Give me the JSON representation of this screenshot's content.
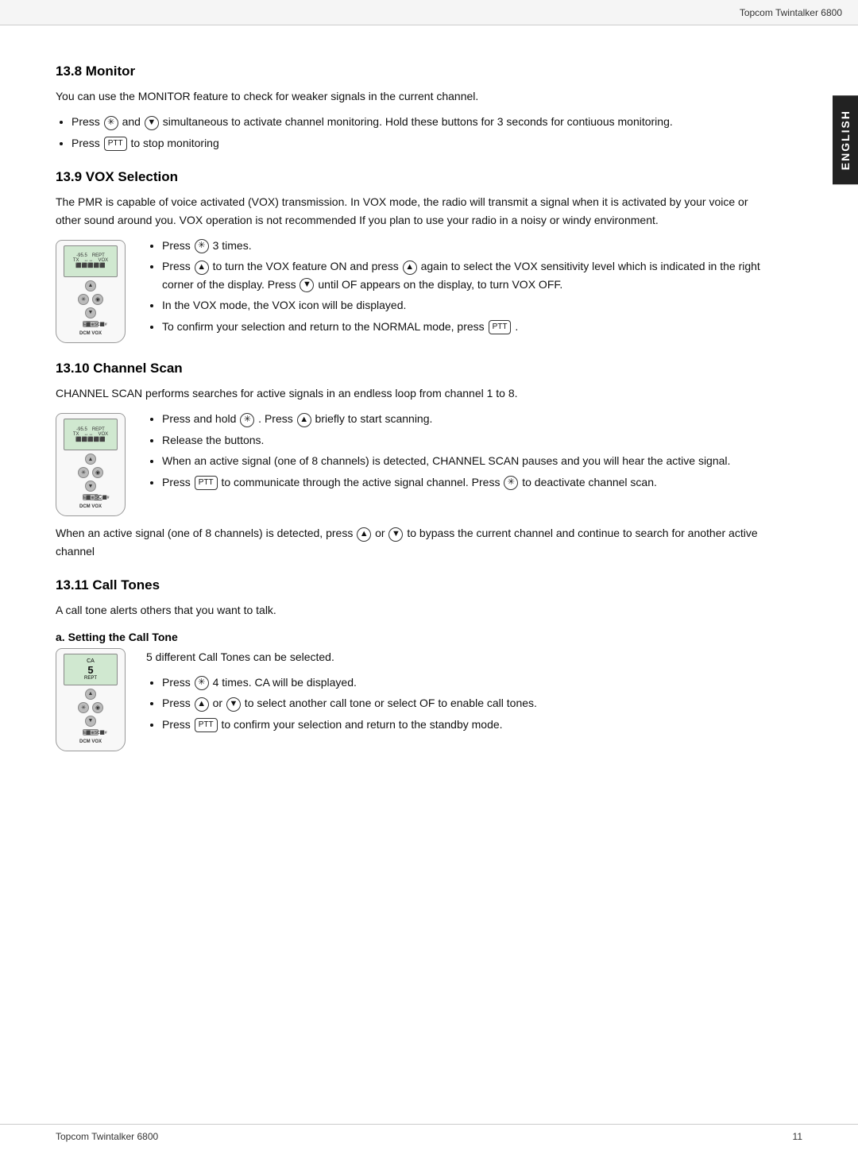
{
  "header": {
    "title": "Topcom Twintalker 6800"
  },
  "side_tab": {
    "label": "ENGLISH"
  },
  "sections": {
    "s13_8": {
      "heading": "13.8   Monitor",
      "intro": "You can use the MONITOR feature to check for weaker signals in the current channel.",
      "bullets": [
        "Press ⊛ and ▼ simultaneous to activate channel monitoring. Hold these buttons for 3 seconds for contiuous monitoring.",
        "Press PTT to stop monitoring"
      ]
    },
    "s13_9": {
      "heading": "13.9   VOX Selection",
      "intro": "The PMR is capable of voice activated (VOX) transmission. In VOX mode, the radio will transmit a signal when it is activated by your voice or other sound around you. VOX operation is not recommended If you plan to use your radio in a noisy or windy environment.",
      "bullets": [
        "Press ⊛ 3 times.",
        "Press ▲ to turn the VOX feature ON and press ▲ again to select the VOX sensitivity level which is indicated in the right corner of the display. Press ▼ until OF appears on the display, to turn VOX OFF.",
        "In the VOX mode, the VOX icon will be displayed.",
        "To confirm your selection and return to the NORMAL mode, press PTT ."
      ]
    },
    "s13_10": {
      "heading": "13.10  Channel Scan",
      "intro": "CHANNEL SCAN performs searches for active signals in an endless loop from channel 1 to 8.",
      "bullets": [
        "Press and hold ⊛ . Press ▲ briefly to start scanning.",
        "Release the buttons.",
        "When an active signal (one of 8 channels) is detected, CHANNEL SCAN pauses and you will hear the active signal.",
        "Press PTT to communicate through the active signal channel. Press ⊛ to deactivate channel scan."
      ],
      "followup": "When an active signal (one of 8 channels) is detected, press ▲ or ▼ to bypass the current channel and continue to search for another active channel"
    },
    "s13_11": {
      "heading": "13.11  Call Tones",
      "intro": "A call tone alerts others that you want to talk.",
      "sub_a": {
        "heading": "a.   Setting the Call Tone",
        "intro": "5 different Call Tones can be selected.",
        "bullets": [
          "Press ⊛ 4 times. CA will be displayed.",
          "Press ▲ or ▼ to select another call tone or select OF to enable call tones.",
          "Press PTT to confirm your selection and return to the standby mode."
        ]
      }
    }
  },
  "footer": {
    "left": "Topcom Twintalker 6800",
    "right": "11"
  }
}
